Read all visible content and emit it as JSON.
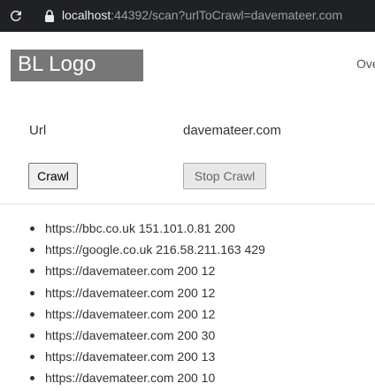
{
  "browser": {
    "url_host": "localhost",
    "url_path": ":44392/scan?urlToCrawl=davemateer.com"
  },
  "header": {
    "logo": "BL Logo",
    "nav_partial": "Ove"
  },
  "form": {
    "url_label": "Url",
    "url_value": "davemateer.com",
    "crawl_label": "Crawl",
    "stop_label": "Stop Crawl"
  },
  "results": [
    "https://bbc.co.uk 151.101.0.81 200",
    "https://google.co.uk 216.58.211.163 429",
    "https://davemateer.com 200 12",
    "https://davemateer.com 200 12",
    "https://davemateer.com 200 12",
    "https://davemateer.com 200 30",
    "https://davemateer.com 200 13",
    "https://davemateer.com 200 10"
  ],
  "icons": {
    "reload": "reload-icon",
    "lock": "lock-icon"
  }
}
